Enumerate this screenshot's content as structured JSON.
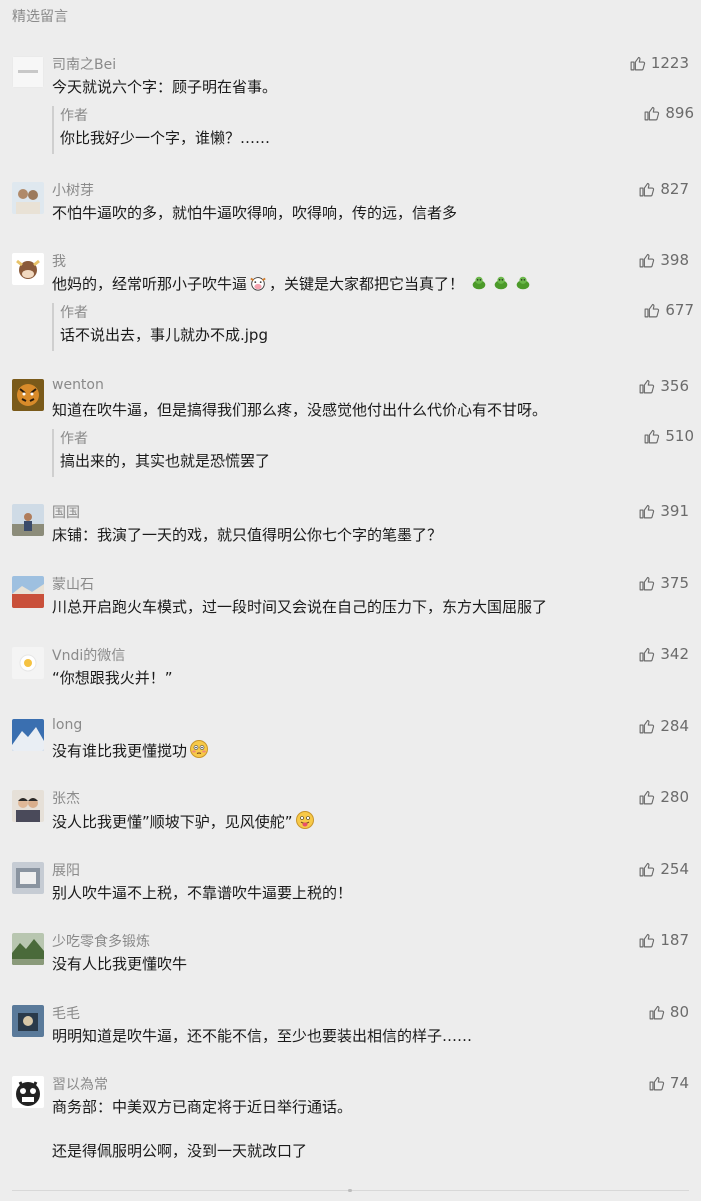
{
  "section_title": "精选留言",
  "comments": [
    {
      "nick": "司南之Bei",
      "text": "今天就说六个字：顾子明在省事。",
      "likes": "1223",
      "reply": {
        "label": "作者",
        "text": "你比我好少一个字，谁懒？……",
        "likes": "896"
      }
    },
    {
      "nick": "小树芽",
      "text": "不怕牛逼吹的多，就怕牛逼吹得响，吹得响，传的远，信者多",
      "likes": "827"
    },
    {
      "nick": "我",
      "text_a": "他妈的，经常听那小子吹牛逼",
      "text_b": "，关键是大家都把它当真了！",
      "likes": "398",
      "reply": {
        "label": "作者",
        "text": "话不说出去，事儿就办不成.jpg",
        "likes": "677"
      }
    },
    {
      "nick": "wenton",
      "text": "知道在吹牛逼，但是搞得我们那么疼，没感觉他付出什么代价心有不甘呀。",
      "likes": "356",
      "reply": {
        "label": "作者",
        "text": "搞出来的，其实也就是恐慌罢了",
        "likes": "510"
      }
    },
    {
      "nick": "国国",
      "text": "床铺：我演了一天的戏，就只值得明公你七个字的笔墨了？",
      "likes": "391"
    },
    {
      "nick": "蒙山石",
      "text": "川总开启跑火车模式，过一段时间又会说在自己的压力下，东方大国屈服了",
      "likes": "375"
    },
    {
      "nick": "Vndi的微信",
      "text": "“你想跟我火并！”",
      "likes": "342"
    },
    {
      "nick": "long",
      "text": "没有谁比我更懂搅功",
      "likes": "284"
    },
    {
      "nick": "张杰",
      "text": "没人比我更懂”顺坡下驴，见风使舵”",
      "likes": "280"
    },
    {
      "nick": "展阳",
      "text": "别人吹牛逼不上税，不靠谱吹牛逼要上税的！",
      "likes": "254"
    },
    {
      "nick": "少吃零食多锻炼",
      "text": "没有人比我更懂吹牛",
      "likes": "187"
    },
    {
      "nick": "毛毛",
      "text": "明明知道是吹牛逼，还不能不信，至少也要装出相信的样子……",
      "likes": "80"
    },
    {
      "nick": "習以為常",
      "text": "商务部：中美双方已商定将于近日举行通话。",
      "text2": "还是得佩服明公啊，没到一天就改口了",
      "likes": "74"
    }
  ],
  "icons": {
    "like": "thumbs-up-icon",
    "emoji_cow": "cow-face-icon",
    "emoji_turtle": "turtle-icon",
    "emoji_flushed": "flushed-face-icon",
    "emoji_tongue": "tongue-face-icon"
  },
  "colors": {
    "background": "#ededed",
    "meta_text": "#8a8a8a",
    "body_text": "#1a1a1a",
    "reply_bar": "#cfcfcf"
  }
}
